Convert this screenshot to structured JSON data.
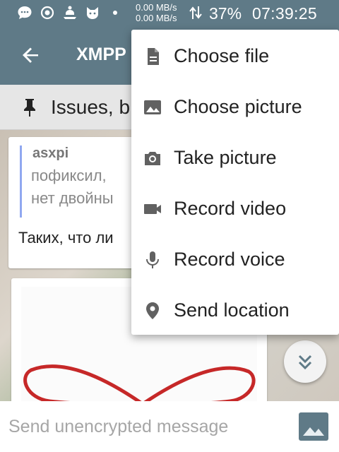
{
  "status_bar": {
    "net_up": "0.00 MB/s",
    "net_down": "0.00 MB/s",
    "battery": "37%",
    "time": "07:39:25"
  },
  "app_bar": {
    "title": "XMPP"
  },
  "topic": {
    "text": "Issues, b"
  },
  "messages": {
    "quote_author": "asxpi",
    "quote_line1": "пофиксил,",
    "quote_line2": "нет двойны",
    "body": "Таких, что ли"
  },
  "composer": {
    "placeholder": "Send unencrypted message"
  },
  "menu": {
    "items": [
      {
        "label": "Choose file",
        "icon": "file-icon"
      },
      {
        "label": "Choose picture",
        "icon": "image-icon"
      },
      {
        "label": "Take picture",
        "icon": "camera-icon"
      },
      {
        "label": "Record video",
        "icon": "videocam-icon"
      },
      {
        "label": "Record voice",
        "icon": "mic-icon"
      },
      {
        "label": "Send location",
        "icon": "location-icon"
      }
    ]
  },
  "colors": {
    "app_bar": "#5f7a87",
    "menu_icon": "#616161",
    "quote_bar": "#90a8f0",
    "heart_stroke": "#c62828"
  }
}
